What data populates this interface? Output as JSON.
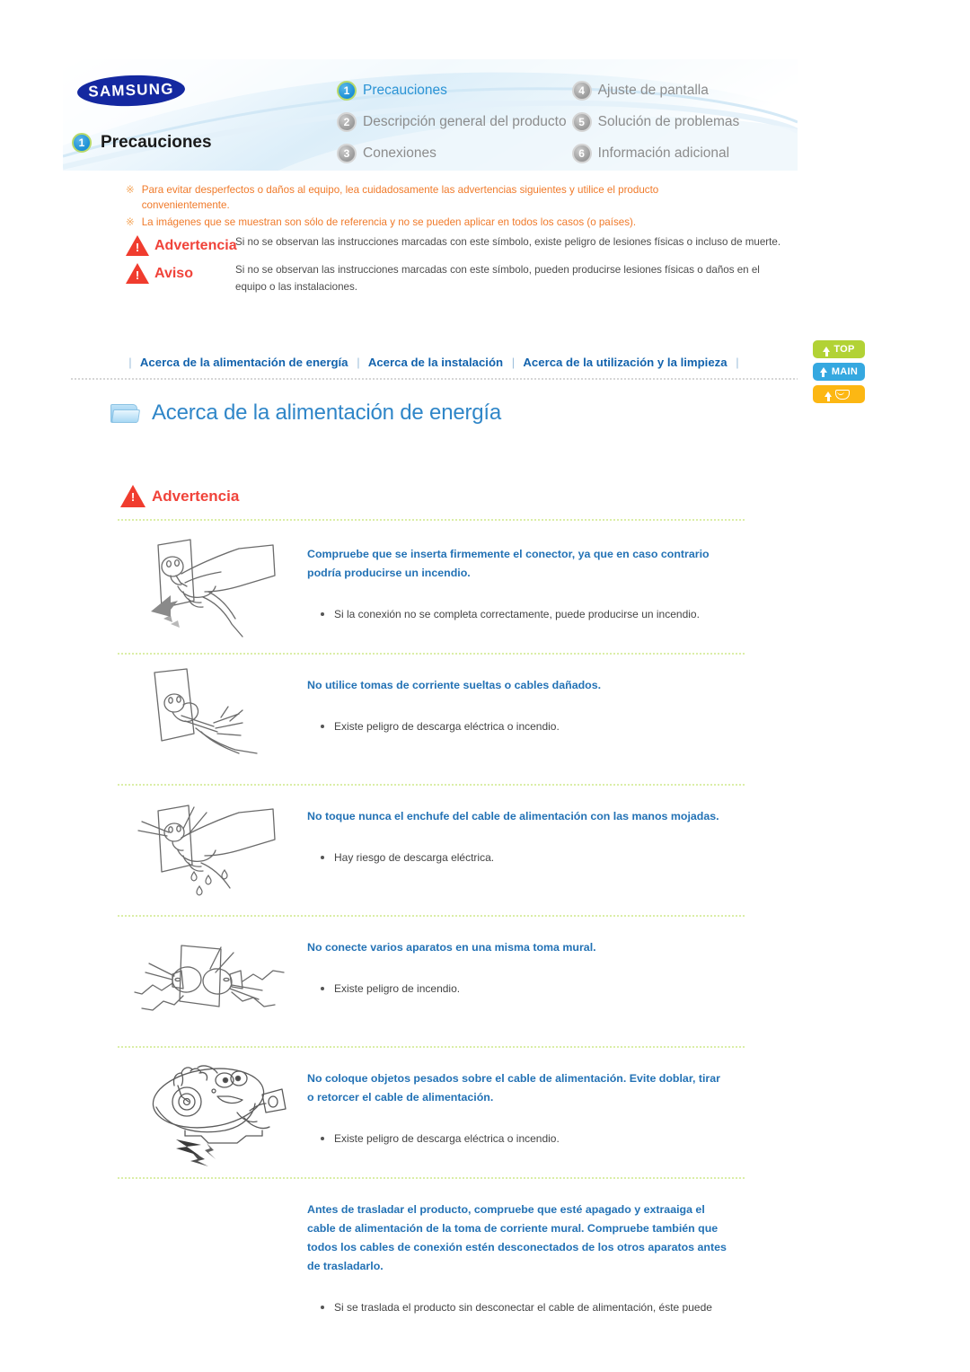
{
  "header": {
    "brand": "SAMSUNG",
    "current_section_number": "1",
    "current_section_label": "Precauciones",
    "nav_items": [
      {
        "number": "1",
        "label": "Precauciones",
        "active": true
      },
      {
        "number": "4",
        "label": "Ajuste de pantalla",
        "active": false
      },
      {
        "number": "2",
        "label": "Descripción general del producto",
        "active": false
      },
      {
        "number": "5",
        "label": "Solución de problemas",
        "active": false
      },
      {
        "number": "3",
        "label": "Conexiones",
        "active": false
      },
      {
        "number": "6",
        "label": "Información adicional",
        "active": false
      }
    ]
  },
  "notices": {
    "mark": "※",
    "items": [
      "Para evitar desperfectos o daños al equipo, lea cuidadosamente las advertencias siguientes y utilice el producto convenientemente.",
      "La imágenes que se muestran son sólo de referencia y no se pueden aplicar en todos los casos (o países)."
    ],
    "symbols": [
      {
        "name": "Advertencia",
        "description": "Si no se observan las instrucciones marcadas con este símbolo, existe peligro de lesiones físicas o incluso de muerte."
      },
      {
        "name": "Aviso",
        "description": "Si no se observan las instrucciones marcadas con este símbolo, pueden producirse lesiones físicas o daños en el equipo o las instalaciones."
      }
    ]
  },
  "linkbar": {
    "separator": "|",
    "links": [
      "Acerca de la alimentación de energía",
      "Acerca de la instalación",
      "Acerca de la utilización y la limpieza"
    ]
  },
  "side_buttons": [
    {
      "label": "TOP",
      "color": "#b2d235",
      "icon": "arrow-up-icon"
    },
    {
      "label": "MAIN",
      "color": "#35a8e0",
      "icon": "bent-arrow-icon"
    },
    {
      "label": "",
      "color": "#fcb713",
      "icon": "envelope-icon"
    }
  ],
  "section": {
    "title": "Acerca de la alimentación de energía",
    "warning_label": "Advertencia"
  },
  "blocks": [
    {
      "illustration": "hand-inserting-plug-into-wall-outlet",
      "title": "Compruebe que se inserta firmemente el conector, ya que en caso contrario podría producirse un incendio.",
      "bullets": [
        "Si la conexión no se completa correctamente, puede producirse un incendio."
      ]
    },
    {
      "illustration": "loose-outlet-with-damaged-cable",
      "title": "No utilice tomas de corriente sueltas o cables dañados.",
      "bullets": [
        "Existe peligro de descarga eléctrica o incendio."
      ]
    },
    {
      "illustration": "wet-hand-touching-plug",
      "title": "No toque nunca el enchufe del cable de alimentación con las manos mojadas.",
      "bullets": [
        "Hay riesgo de descarga eléctrica."
      ]
    },
    {
      "illustration": "multiple-plugs-in-one-outlet",
      "title": "No conecte varios aparatos en una misma toma mural.",
      "bullets": [
        "Existe peligro de incendio."
      ]
    },
    {
      "illustration": "heavy-object-on-power-cable",
      "title": "No coloque objetos pesados sobre el cable de alimentación. Evite doblar, tirar o retorcer el cable de alimentación.",
      "bullets": [
        "Existe peligro de descarga eléctrica o incendio."
      ]
    },
    {
      "illustration": "none",
      "title": "Antes de trasladar el producto, compruebe que esté apagado y extraaiga el cable de alimentación de la toma de corriente mural. Compruebe también que todos los cables de conexión estén desconectados de los otros aparatos antes de trasladarlo.",
      "bullets": [
        "Si se traslada el producto sin desconectar el cable de alimentación, éste puede"
      ]
    }
  ]
}
